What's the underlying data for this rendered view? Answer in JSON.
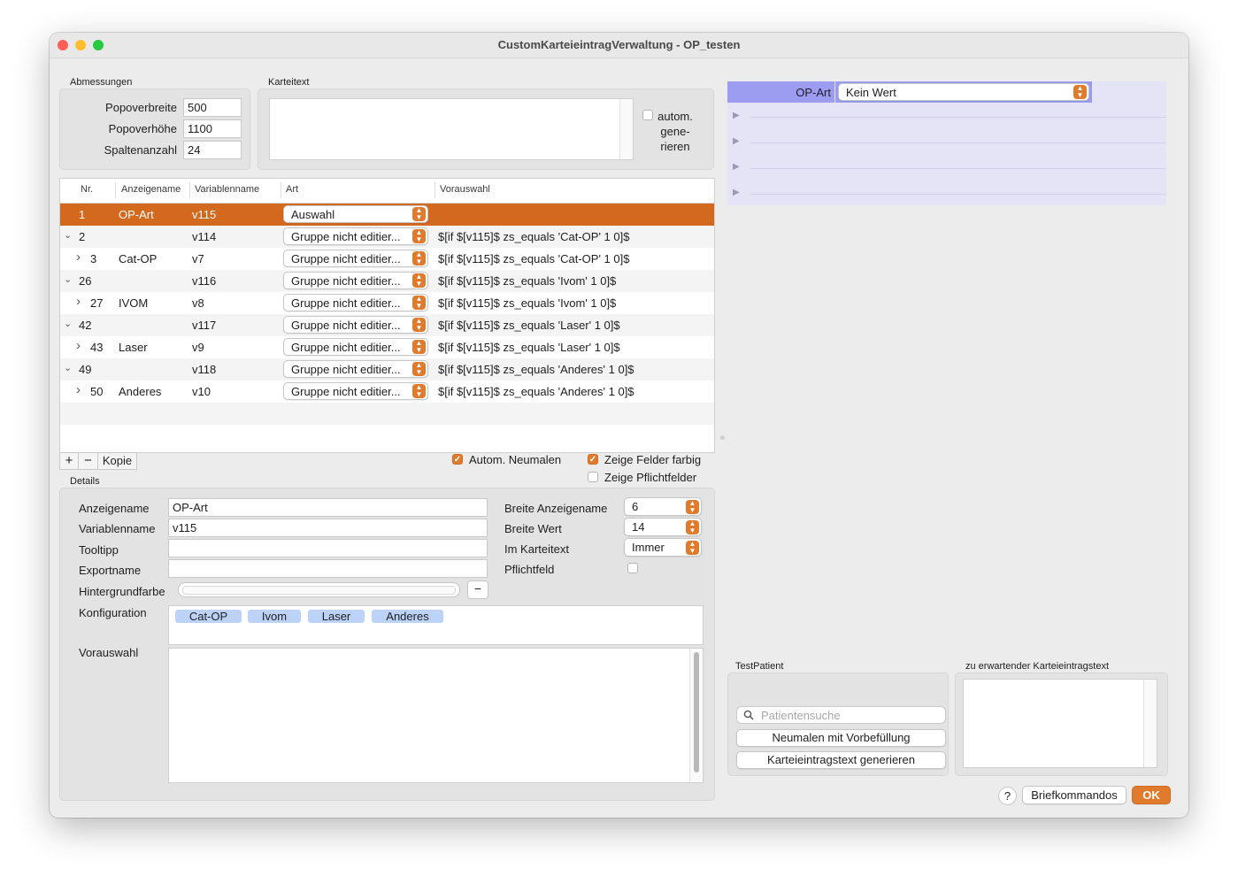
{
  "window": {
    "title": "CustomKarteieintragVerwaltung - OP_testen",
    "traffic_lights": {
      "close": "#ff5f57",
      "minimize": "#febc2e",
      "zoom": "#28c840"
    }
  },
  "abmessungen": {
    "label": "Abmessungen",
    "popoverbreite_label": "Popoverbreite",
    "popoverbreite_value": "500",
    "popoverhoehe_label": "Popoverhöhe",
    "popoverhoehe_value": "1100",
    "spaltenanzahl_label": "Spaltenanzahl",
    "spaltenanzahl_value": "24"
  },
  "karteitext": {
    "label": "Karteitext",
    "value": "",
    "autom_generieren": [
      "autom.",
      "gene-",
      "rieren"
    ],
    "autom_checked": false
  },
  "table": {
    "headers": [
      "Nr.",
      "Anzeigename",
      "Variablenname",
      "Art",
      "Vorauswahl"
    ],
    "rows": [
      {
        "nr": "1",
        "name": "OP-Art",
        "var": "v115",
        "art": "Auswahl",
        "vorauswahl": "",
        "selected": true,
        "disclosure": "",
        "indent": 0
      },
      {
        "nr": "2",
        "name": "",
        "var": "v114",
        "art": "Gruppe nicht editier...",
        "vorauswahl": "$[if $[v115]$ zs_equals 'Cat-OP' 1 0]$",
        "disclosure": "down",
        "indent": 0
      },
      {
        "nr": "3",
        "name": "Cat-OP",
        "var": "v7",
        "art": "Gruppe nicht editier...",
        "vorauswahl": "$[if $[v115]$ zs_equals 'Cat-OP' 1 0]$",
        "disclosure": "right",
        "indent": 1
      },
      {
        "nr": "26",
        "name": "",
        "var": "v116",
        "art": "Gruppe nicht editier...",
        "vorauswahl": "$[if $[v115]$ zs_equals 'Ivom' 1 0]$",
        "disclosure": "down",
        "indent": 0
      },
      {
        "nr": "27",
        "name": "IVOM",
        "var": "v8",
        "art": "Gruppe nicht editier...",
        "vorauswahl": "$[if $[v115]$ zs_equals 'Ivom' 1 0]$",
        "disclosure": "right",
        "indent": 1
      },
      {
        "nr": "42",
        "name": "",
        "var": "v117",
        "art": "Gruppe nicht editier...",
        "vorauswahl": "$[if $[v115]$ zs_equals 'Laser' 1 0]$",
        "disclosure": "down",
        "indent": 0
      },
      {
        "nr": "43",
        "name": "Laser",
        "var": "v9",
        "art": "Gruppe nicht editier...",
        "vorauswahl": "$[if $[v115]$ zs_equals 'Laser' 1 0]$",
        "disclosure": "right",
        "indent": 1
      },
      {
        "nr": "49",
        "name": "",
        "var": "v118",
        "art": "Gruppe nicht editier...",
        "vorauswahl": "$[if $[v115]$ zs_equals 'Anderes' 1 0]$",
        "disclosure": "down",
        "indent": 0
      },
      {
        "nr": "50",
        "name": "Anderes",
        "var": "v10",
        "art": "Gruppe nicht editier...",
        "vorauswahl": "$[if $[v115]$ zs_equals 'Anderes' 1 0]$",
        "disclosure": "right",
        "indent": 1
      }
    ]
  },
  "table_toolbar": {
    "add": "+",
    "remove": "−",
    "kopie": "Kopie",
    "autom_neumalen": "Autom. Neumalen",
    "autom_neumalen_checked": true,
    "zeige_felder_farbig": "Zeige Felder farbig",
    "zeige_felder_farbig_checked": true,
    "zeige_pflichtfelder": "Zeige Pflichtfelder",
    "zeige_pflichtfelder_checked": false
  },
  "details": {
    "label": "Details",
    "anzeigename_label": "Anzeigename",
    "anzeigename_value": "OP-Art",
    "variablenname_label": "Variablenname",
    "variablenname_value": "v115",
    "tooltipp_label": "Tooltipp",
    "tooltipp_value": "",
    "exportname_label": "Exportname",
    "exportname_value": "",
    "hintergrundfarbe_label": "Hintergrundfarbe",
    "hintergrundfarbe_remove": "−",
    "konfiguration_label": "Konfiguration",
    "konfiguration_tokens": [
      "Cat-OP",
      "Ivom",
      "Laser",
      "Anderes"
    ],
    "vorauswahl_label": "Vorauswahl",
    "vorauswahl_value": "",
    "breite_anzeigename_label": "Breite Anzeigename",
    "breite_anzeigename_value": "6",
    "breite_wert_label": "Breite Wert",
    "breite_wert_value": "14",
    "im_karteitext_label": "Im Karteitext",
    "im_karteitext_value": "Immer",
    "pflichtfeld_label": "Pflichtfeld",
    "pflichtfeld_checked": false
  },
  "preview": {
    "field_label": "OP-Art",
    "field_value": "Kein Wert",
    "accent": "#9c9cf0",
    "background": "#e4e4f6",
    "collapsed_groups": 4
  },
  "testpatient": {
    "label": "TestPatient",
    "search_placeholder": "Patientensuche",
    "neumalen_button": "Neumalen mit Vorbefüllung",
    "generieren_button": "Karteieintragstext generieren"
  },
  "erwartet": {
    "label": "zu erwartender Karteieintragstext",
    "value": ""
  },
  "footer": {
    "help": "?",
    "briefkommandos": "Briefkommandos",
    "ok": "OK"
  },
  "colors": {
    "accent_orange": "#e07a2c",
    "selection": "#d2691e",
    "token": "#bcd3f7"
  }
}
